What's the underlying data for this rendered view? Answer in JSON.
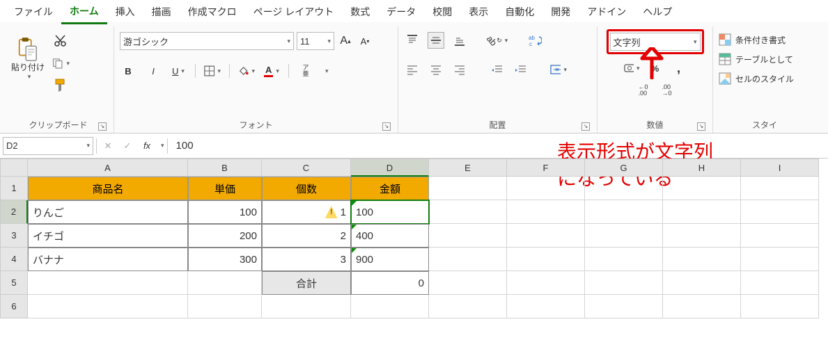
{
  "menu": [
    "ファイル",
    "ホーム",
    "挿入",
    "描画",
    "作成マクロ",
    "ページ レイアウト",
    "数式",
    "データ",
    "校閲",
    "表示",
    "自動化",
    "開発",
    "アドイン",
    "ヘルプ"
  ],
  "menu_active": 1,
  "ribbon": {
    "clipboard": {
      "label": "クリップボード",
      "paste": "貼り付け"
    },
    "font": {
      "label": "フォント",
      "family": "游ゴシック",
      "size": "11",
      "ruby": "ア\n亜"
    },
    "align": {
      "label": "配置"
    },
    "number": {
      "label": "数値",
      "format": "文字列"
    },
    "styles": {
      "label": "スタイ",
      "cond": "条件付き書式",
      "table": "テーブルとして",
      "cell": "セルのスタイル"
    }
  },
  "fbar": {
    "name": "D2",
    "fx": "fx",
    "value": "100"
  },
  "annotation_text": "表示形式が文字列\nになっている",
  "cols": [
    "A",
    "B",
    "C",
    "D",
    "E",
    "F",
    "G",
    "H",
    "I"
  ],
  "colw": [
    "cA",
    "cB",
    "cC",
    "cD",
    "cE",
    "cF",
    "cG",
    "cH",
    "cI"
  ],
  "selected_col": 3,
  "selected_row": 2,
  "headers": [
    "商品名",
    "単価",
    "個数",
    "金額"
  ],
  "rows": [
    {
      "name": "りんご",
      "price": "100",
      "qty": "1",
      "amt": "100",
      "warn": true
    },
    {
      "name": "イチゴ",
      "price": "200",
      "qty": "2",
      "amt": "400",
      "warn": false
    },
    {
      "name": "バナナ",
      "price": "300",
      "qty": "3",
      "amt": "900",
      "warn": false
    }
  ],
  "total_label": "合計",
  "total_value": "0"
}
